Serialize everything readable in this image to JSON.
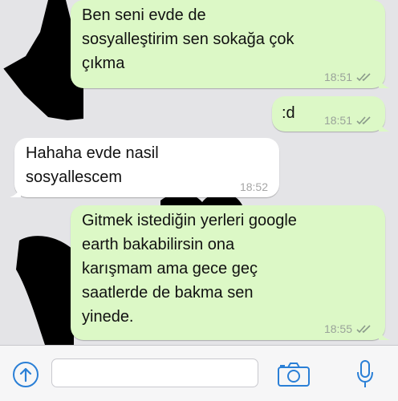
{
  "messages": [
    {
      "direction": "outgoing",
      "text": "Ben seni evde de\nsosyalleştirim sen sokağa çok\nçıkma",
      "time": "18:51"
    },
    {
      "direction": "outgoing",
      "text": ":d",
      "time": "18:51"
    },
    {
      "direction": "incoming",
      "text": "Hahaha evde nasil\nsosyallescem",
      "time": "18:52"
    },
    {
      "direction": "outgoing",
      "text": "Gitmek istediğin yerleri google\nearth bakabilirsin ona\nkarışmam ama gece geç\nsaatlerde de bakma sen\nyinede.",
      "time": "18:55"
    }
  ],
  "composer": {
    "attach_icon": "share-icon",
    "input_value": "",
    "camera_icon": "camera-icon",
    "mic_icon": "microphone-icon"
  },
  "colors": {
    "outgoing": "#dcf8c6",
    "incoming": "#ffffff",
    "accent": "#2a7fd6",
    "wallpaper_shape": "#000000"
  }
}
